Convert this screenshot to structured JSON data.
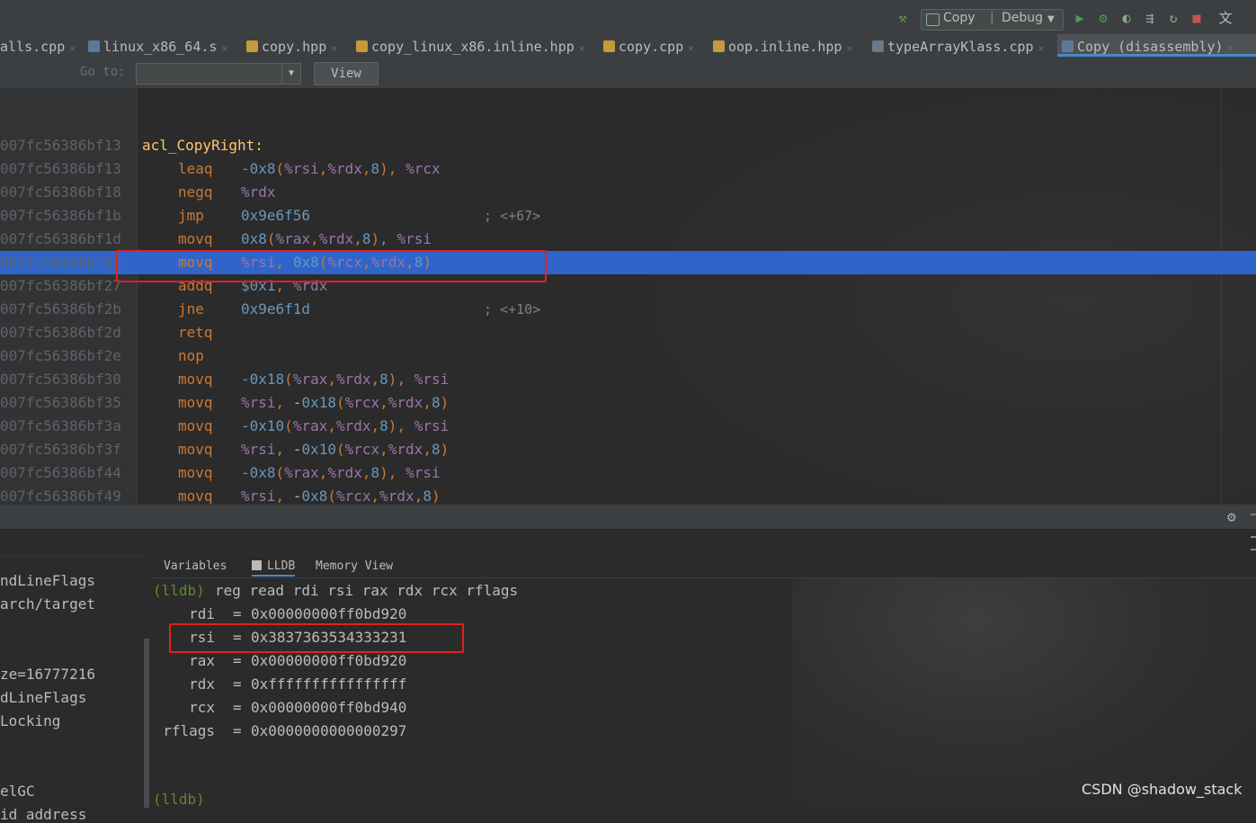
{
  "toolbar": {
    "run_config_target": "Copy",
    "run_config_separator": "|",
    "run_config_mode": "Debug"
  },
  "tabs": [
    {
      "label": "alls.cpp",
      "type": "cpp"
    },
    {
      "label": "linux_x86_64.s",
      "type": "s"
    },
    {
      "label": "copy.hpp",
      "type": "h"
    },
    {
      "label": "copy_linux_x86.inline.hpp",
      "type": "h"
    },
    {
      "label": "copy.cpp",
      "type": "h"
    },
    {
      "label": "oop.inline.hpp",
      "type": "h"
    },
    {
      "label": "typeArrayKlass.cpp",
      "type": "cpp"
    },
    {
      "label": "Copy (disassembly)",
      "type": "asm",
      "active": true
    }
  ],
  "goto": {
    "label": "Go to:",
    "value": "",
    "view_button": "View"
  },
  "disassembly": {
    "label": "acl_CopyRight:",
    "lines": [
      {
        "addr": "007fc56386bf13",
        "mnemonic": "",
        "operands": "",
        "comment": ""
      },
      {
        "addr": "007fc56386bf13",
        "mnemonic": "leaq",
        "operands": "-0x8(%rsi,%rdx,8), %rcx",
        "comment": ""
      },
      {
        "addr": "007fc56386bf18",
        "mnemonic": "negq",
        "operands": "%rdx",
        "comment": ""
      },
      {
        "addr": "007fc56386bf1b",
        "mnemonic": "jmp",
        "operands": "0x9e6f56",
        "comment": "; <+67>"
      },
      {
        "addr": "007fc56386bf1d",
        "mnemonic": "movq",
        "operands": "0x8(%rax,%rdx,8), %rsi",
        "comment": ""
      },
      {
        "addr": "007fc56386bf22",
        "mnemonic": "movq",
        "operands": "%rsi, 0x8(%rcx,%rdx,8)",
        "comment": "",
        "highlight": true
      },
      {
        "addr": "007fc56386bf27",
        "mnemonic": "addq",
        "operands": "$0x1, %rdx",
        "comment": ""
      },
      {
        "addr": "007fc56386bf2b",
        "mnemonic": "jne",
        "operands": "0x9e6f1d",
        "comment": "; <+10>"
      },
      {
        "addr": "007fc56386bf2d",
        "mnemonic": "retq",
        "operands": "",
        "comment": ""
      },
      {
        "addr": "007fc56386bf2e",
        "mnemonic": "nop",
        "operands": "",
        "comment": ""
      },
      {
        "addr": "007fc56386bf30",
        "mnemonic": "movq",
        "operands": "-0x18(%rax,%rdx,8), %rsi",
        "comment": ""
      },
      {
        "addr": "007fc56386bf35",
        "mnemonic": "movq",
        "operands": "%rsi, -0x18(%rcx,%rdx,8)",
        "comment": ""
      },
      {
        "addr": "007fc56386bf3a",
        "mnemonic": "movq",
        "operands": "-0x10(%rax,%rdx,8), %rsi",
        "comment": ""
      },
      {
        "addr": "007fc56386bf3f",
        "mnemonic": "movq",
        "operands": "%rsi, -0x10(%rcx,%rdx,8)",
        "comment": ""
      },
      {
        "addr": "007fc56386bf44",
        "mnemonic": "movq",
        "operands": "-0x8(%rax,%rdx,8), %rsi",
        "comment": ""
      },
      {
        "addr": "007fc56386bf49",
        "mnemonic": "movq",
        "operands": "%rsi, -0x8(%rcx,%rdx,8)",
        "comment": ""
      }
    ]
  },
  "debug": {
    "tabs": [
      "Variables",
      "LLDB",
      "Memory View"
    ],
    "active_tab": "LLDB",
    "frames": [
      "ndLineFlags",
      "arch/target",
      "",
      "",
      "ze=16777216",
      "dLineFlags",
      "Locking",
      "",
      "",
      "elGC",
      "id address"
    ],
    "console": {
      "prompt": "(lldb)",
      "command": "reg read rdi rsi rax rdx rcx rflags",
      "registers": [
        {
          "name": "rdi",
          "value": "0x00000000ff0bd920"
        },
        {
          "name": "rsi",
          "value": "0x3837363534333231",
          "highlight": true
        },
        {
          "name": "rax",
          "value": "0x00000000ff0bd920"
        },
        {
          "name": "rdx",
          "value": "0xffffffffffffffff"
        },
        {
          "name": "rcx",
          "value": "0x00000000ff0bd940"
        },
        {
          "name": "rflags",
          "value": "0x0000000000000297"
        }
      ],
      "final_prompt": "(lldb)"
    }
  },
  "watermark": "CSDN @shadow_stack",
  "colors": {
    "highlight_row": "#2f65ca",
    "annotation_box": "#e02020",
    "mnemonic": "#cc7832",
    "register": "#9876aa",
    "number": "#6897bb",
    "label": "#ffc66d"
  }
}
